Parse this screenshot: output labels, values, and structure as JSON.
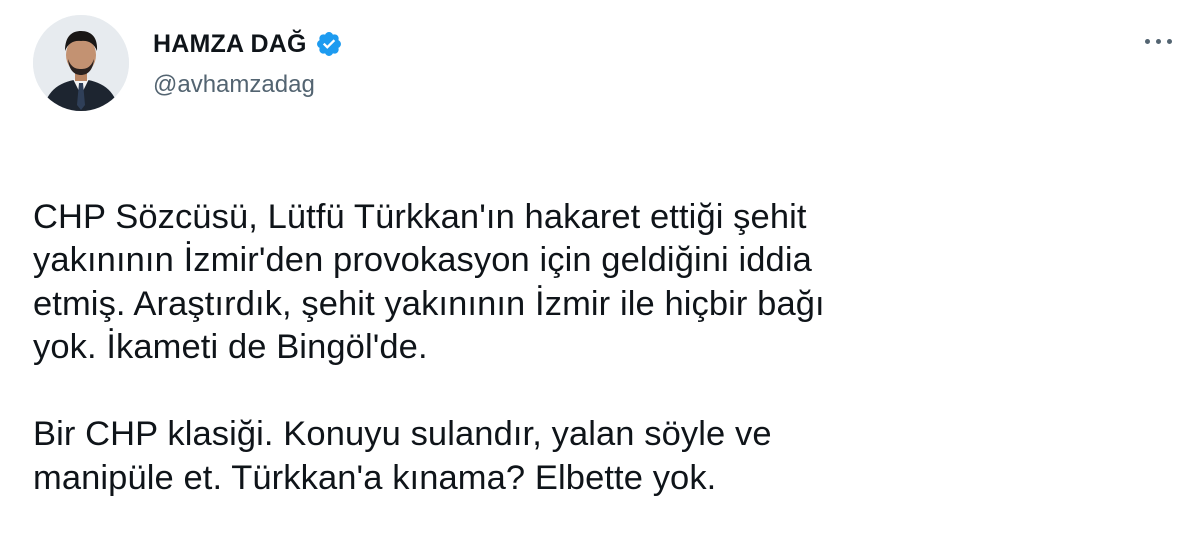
{
  "author": {
    "display_name": "HAMZA DAĞ",
    "handle": "@avhamzadag",
    "verified": true,
    "avatar_icon": "profile-photo"
  },
  "more_icon": "more-options-icon",
  "tweet": {
    "paragraphs": [
      "CHP Sözcüsü, Lütfü Türkkan'ın hakaret ettiği şehit\nyakınının İzmir'den provokasyon için geldiğini iddia\netmiş. Araştırdık, şehit yakınının İzmir ile hiçbir bağı\nyok. İkameti de Bingöl'de.",
      "Bir CHP klasiği. Konuyu sulandır, yalan söyle ve\nmanipüle et. Türkkan'a kınama? Elbette yok."
    ]
  },
  "colors": {
    "verified_badge": "#1d9bf0",
    "handle_gray": "#536471",
    "text": "#0f1419"
  }
}
